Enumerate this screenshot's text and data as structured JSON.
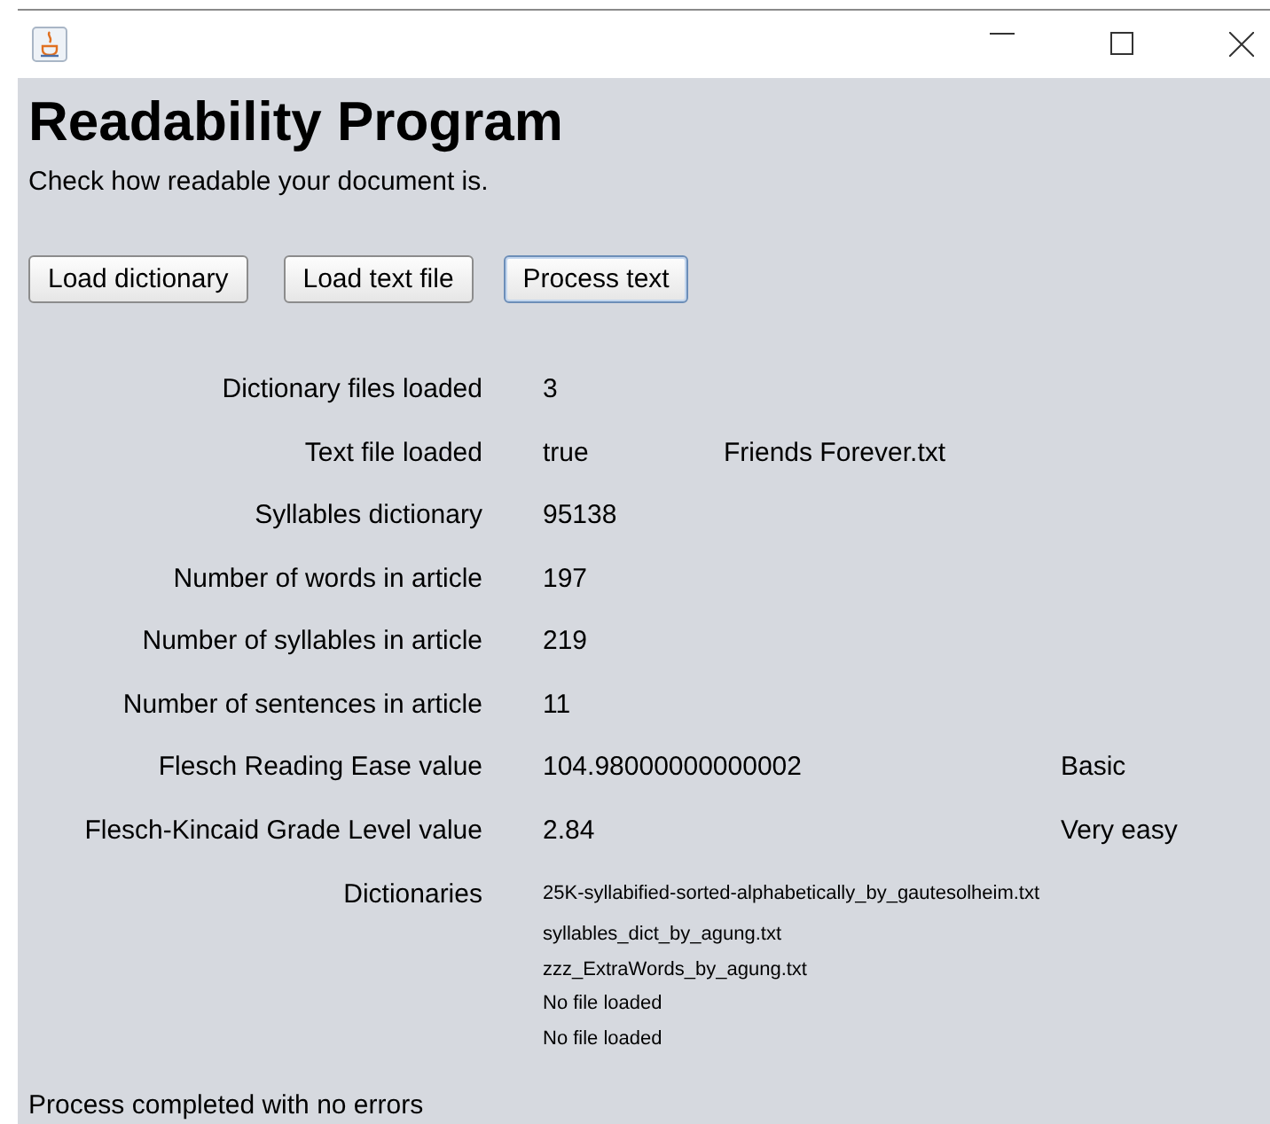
{
  "header": {
    "title": "Readability Program",
    "subtitle": "Check how readable your document is."
  },
  "buttons": [
    {
      "label": "Load dictionary",
      "focused": false
    },
    {
      "label": "Load text file",
      "focused": false
    },
    {
      "label": "Process text",
      "focused": true
    }
  ],
  "rows": [
    {
      "label": "Dictionary files loaded",
      "value": "3"
    },
    {
      "label": "Text file loaded",
      "value": "true",
      "extra": "Friends Forever.txt",
      "kind": "file"
    },
    {
      "label": "Syllables dictionary",
      "value": "95138"
    },
    {
      "label": "Number of words in article",
      "value": "197"
    },
    {
      "label": "Number of syllables in article",
      "value": "219"
    },
    {
      "label": "Number of sentences in article",
      "value": "11"
    },
    {
      "label": "Flesch Reading Ease value",
      "value": "104.98000000000002",
      "extra": "Basic",
      "kind": "rating"
    },
    {
      "label": "Flesch-Kincaid Grade Level value",
      "value": "2.84",
      "extra": "Very easy",
      "kind": "rating"
    }
  ],
  "dictionaries": {
    "label": "Dictionaries",
    "files": [
      "25K-syllabified-sorted-alphabetically_by_gautesolheim.txt",
      "syllables_dict_by_agung.txt",
      "zzz_ExtraWords_by_agung.txt",
      "No file loaded",
      "No file loaded"
    ]
  },
  "status_bar": "Process completed with no errors"
}
